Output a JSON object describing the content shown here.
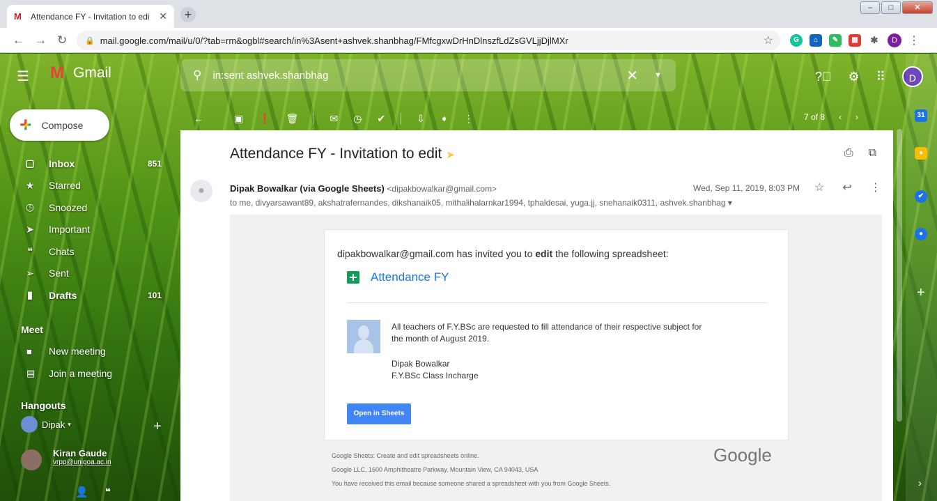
{
  "browser": {
    "tab_title": "Attendance FY - Invitation to edi",
    "url": "mail.google.com/mail/u/0/?tab=rm&ogbl#search/in%3Asent+ashvek.shanbhag/FMfcgxwDrHnDlnszfLdZsGVLjjDjlMXr",
    "profile_initial": "D"
  },
  "gmail": {
    "app_name": "Gmail",
    "search_query": "in:sent ashvek.shanbhag",
    "avatar_initial": "D"
  },
  "compose_label": "Compose",
  "nav": [
    {
      "label": "Inbox",
      "count": "851",
      "icon": "inbox-icon",
      "glyph": "▢"
    },
    {
      "label": "Starred",
      "count": "",
      "icon": "star-icon",
      "glyph": "★"
    },
    {
      "label": "Snoozed",
      "count": "",
      "icon": "clock-icon",
      "glyph": "◷"
    },
    {
      "label": "Important",
      "count": "",
      "icon": "important-icon",
      "glyph": "➤"
    },
    {
      "label": "Chats",
      "count": "",
      "icon": "chat-icon",
      "glyph": "❝"
    },
    {
      "label": "Sent",
      "count": "",
      "icon": "send-icon",
      "glyph": "➢"
    },
    {
      "label": "Drafts",
      "count": "101",
      "icon": "draft-icon",
      "glyph": "▮"
    }
  ],
  "meet": {
    "heading": "Meet",
    "new_meeting": "New meeting",
    "join_meeting": "Join a meeting"
  },
  "hangouts": {
    "heading": "Hangouts",
    "user": "Dipak",
    "contact_name": "Kiran Gaude",
    "contact_email": "vrpp@unigoa.ac.in"
  },
  "pager": {
    "text": "7 of 8"
  },
  "email": {
    "subject": "Attendance FY - Invitation to edit",
    "sender_name": "Dipak Bowalkar (via Google Sheets)",
    "sender_addr": "<dipakbowalkar@gmail.com>",
    "recipients": "to me, divyarsawant89, akshatrafernandes, dikshanaik05, mithalihalarnkar1994, tphaldesai, yuga.jj, snehanaik0311, ashvek.shanbhag ▾",
    "datetime": "Wed, Sep 11, 2019, 8:03 PM",
    "invite_prefix": "dipakbowalkar@gmail.com has invited you to ",
    "invite_bold": "edit",
    "invite_suffix": " the following spreadsheet:",
    "sheet_name": "Attendance FY",
    "note_line1": "All teachers of F.Y.BSc are requested to fill attendance of their respective subject for",
    "note_line2": "the month of August 2019.",
    "sig_name": "Dipak Bowalkar",
    "sig_title": "F.Y.BSc Class Incharge",
    "open_button": "Open in Sheets",
    "footer1": "Google Sheets: Create and edit spreadsheets online.",
    "footer2": "Google LLC, 1600 Amphitheatre Parkway, Mountain View, CA 94043, USA",
    "footer3": "You have received this email because someone shared a spreadsheet with you from Google Sheets.",
    "google_logo": "Google"
  },
  "colors": {
    "accent": "#4285f4",
    "sheets_green": "#0f9d58",
    "important": "#f9c74f"
  }
}
